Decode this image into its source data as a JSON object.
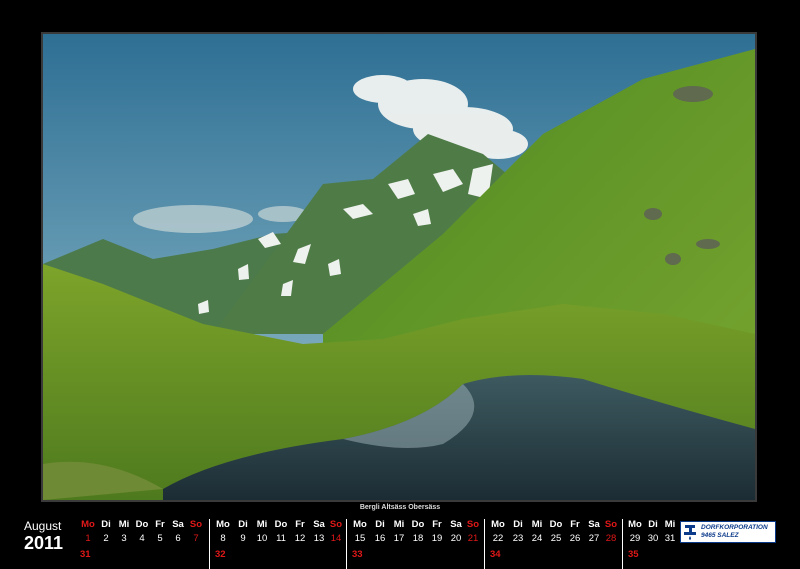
{
  "photo": {
    "caption": "Bergli Altsäss Obersäss"
  },
  "calendar": {
    "month": "August",
    "year": "2011",
    "weeks": [
      {
        "week_no": "31",
        "headers": [
          "Mo"
        ],
        "days": [
          "1"
        ]
      },
      {
        "week_no": "32",
        "headers": [
          "Di",
          "Mi",
          "Do",
          "Fr",
          "Sa",
          "So"
        ],
        "days": [
          "2",
          "3",
          "4",
          "5",
          "6",
          "7"
        ]
      },
      {
        "week_no": "",
        "headers": [
          "Mo",
          "Di",
          "Mi",
          "Do",
          "Fr",
          "Sa",
          "So"
        ],
        "days": [
          "8",
          "9",
          "10",
          "11",
          "12",
          "13",
          "14"
        ]
      },
      {
        "week_no": "33",
        "headers": [
          "Mo",
          "Di",
          "Mi",
          "Do",
          "Fr",
          "Sa",
          "So"
        ],
        "days": [
          "15",
          "16",
          "17",
          "18",
          "19",
          "20",
          "21"
        ]
      },
      {
        "week_no": "34",
        "headers": [
          "Mo",
          "Di",
          "Mi",
          "Do",
          "Fr",
          "Sa",
          "So"
        ],
        "days": [
          "22",
          "23",
          "24",
          "25",
          "26",
          "27",
          "28"
        ]
      },
      {
        "week_no": "35",
        "headers": [
          "Mo",
          "Di",
          "Mi"
        ],
        "days": [
          "29",
          "30",
          "31"
        ]
      }
    ]
  },
  "logo": {
    "line1": "DORFKORPORATION",
    "line2": "9465 SALEZ",
    "icon": "water-tap-icon"
  },
  "colors": {
    "sunday": "#e01818",
    "background": "#000000",
    "logo": "#0b3a8a"
  }
}
